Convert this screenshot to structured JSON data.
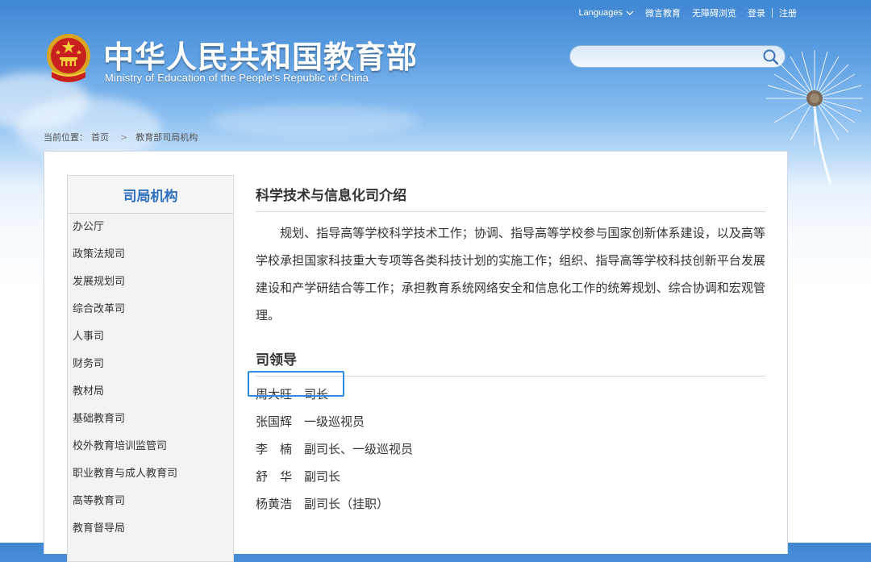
{
  "header": {
    "title_cn": "中华人民共和国教育部",
    "title_en": "Ministry of Education of the People's Republic of China",
    "top_links": {
      "languages": "Languages",
      "weibo": "微言教育",
      "accessibility": "无障碍浏览",
      "login": "登录",
      "register": "注册"
    },
    "search": {
      "placeholder": "",
      "value": ""
    }
  },
  "breadcrumb": {
    "prefix": "当前位置：",
    "items": [
      "首页",
      "教育部司局机构"
    ],
    "separator": ">"
  },
  "sidebar": {
    "title": "司局机构",
    "items": [
      "办公厅",
      "政策法规司",
      "发展规划司",
      "综合改革司",
      "人事司",
      "财务司",
      "教材局",
      "基础教育司",
      "校外教育培训监管司",
      "职业教育与成人教育司",
      "高等教育司",
      "教育督导局"
    ]
  },
  "main": {
    "section1_title": "科学技术与信息化司介绍",
    "intro": "规划、指导高等学校科学技术工作；协调、指导高等学校参与国家创新体系建设，以及高等学校承担国家科技重大专项等各类科技计划的实施工作；组织、指导高等学校科技创新平台发展建设和产学研结合等工作；承担教育系统网络安全和信息化工作的统筹规划、综合协调和宏观管理。",
    "section2_title": "司领导",
    "leaders": [
      {
        "name": "周大旺",
        "title": "司长"
      },
      {
        "name": "张国辉",
        "title": "一级巡视员"
      },
      {
        "name": "李　楠",
        "title": "副司长、一级巡视员"
      },
      {
        "name": "舒　华",
        "title": "副司长"
      },
      {
        "name": "杨黄浩",
        "title": "副司长（挂职）"
      }
    ]
  },
  "colors": {
    "accent": "#2f6ec0",
    "highlight": "#2d8ce8",
    "header_blue": "#3f86d3"
  }
}
